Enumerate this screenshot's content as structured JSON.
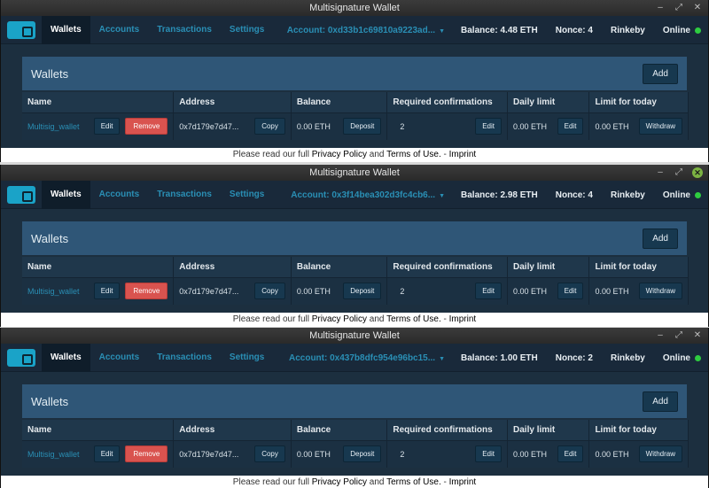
{
  "windows": [
    {
      "title": "Multisignature Wallet",
      "nav": [
        "Wallets",
        "Accounts",
        "Transactions",
        "Settings"
      ],
      "account": "Account: 0xd33b1c69810a9223ad...",
      "balance": "Balance: 4.48 ETH",
      "nonce": "Nonce: 4",
      "network": "Rinkeby",
      "status": "Online"
    },
    {
      "title": "Multisignature Wallet",
      "nav": [
        "Wallets",
        "Accounts",
        "Transactions",
        "Settings"
      ],
      "account": "Account: 0x3f14bea302d3fc4cb6...",
      "balance": "Balance: 2.98 ETH",
      "nonce": "Nonce: 4",
      "network": "Rinkeby",
      "status": "Online"
    },
    {
      "title": "Multisignature Wallet",
      "nav": [
        "Wallets",
        "Accounts",
        "Transactions",
        "Settings"
      ],
      "account": "Account: 0x437b8dfc954e96bc15...",
      "balance": "Balance: 1.00 ETH",
      "nonce": "Nonce: 2",
      "network": "Rinkeby",
      "status": "Online"
    }
  ],
  "panel": {
    "title": "Wallets",
    "add_label": "Add"
  },
  "table": {
    "headers": [
      "Name",
      "Address",
      "Balance",
      "Required confirmations",
      "Daily limit",
      "Limit for today"
    ],
    "row": {
      "name": "Multisig_wallet",
      "edit_label": "Edit",
      "remove_label": "Remove",
      "address": "0x7d179e7d47...",
      "copy_label": "Copy",
      "balance": "0.00 ETH",
      "deposit_label": "Deposit",
      "required": "2",
      "daily_limit": "0.00 ETH",
      "limit_today": "0.00 ETH",
      "withdraw_label": "Withdraw"
    }
  },
  "footer": {
    "prefix": "Please read our full ",
    "privacy": "Privacy Policy",
    "and": " and ",
    "terms": "Terms of Use.",
    "dash": " - ",
    "imprint": "Imprint"
  },
  "colors": {
    "accent": "#2a8fb5",
    "online": "#2ecc40",
    "remove": "#d9534f"
  }
}
